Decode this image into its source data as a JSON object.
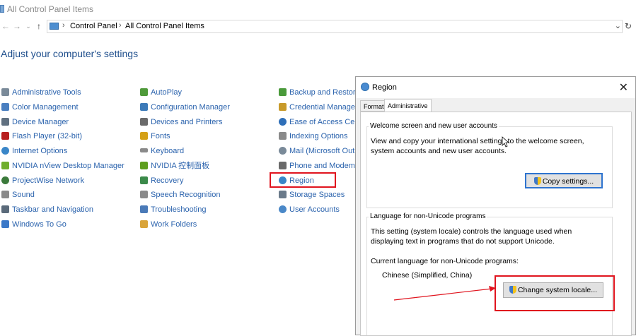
{
  "window": {
    "title": "All Control Panel Items"
  },
  "address": {
    "crumbs": [
      "Control Panel",
      "All Control Panel Items"
    ],
    "sep": "›",
    "back_icon": "back-arrow-icon",
    "forward_icon": "forward-arrow-icon",
    "up_icon": "up-arrow-icon"
  },
  "heading": "Adjust your computer's settings",
  "columns": [
    {
      "items": [
        {
          "label": "Administrative Tools",
          "icon": "admin-tools-icon",
          "color": "#7a8a99"
        },
        {
          "label": "Color Management",
          "icon": "color-management-icon",
          "color": "#4a7fc0"
        },
        {
          "label": "Device Manager",
          "icon": "device-manager-icon",
          "color": "#607080"
        },
        {
          "label": "Flash Player (32-bit)",
          "icon": "flash-player-icon",
          "color": "#b81f1f"
        },
        {
          "label": "Internet Options",
          "icon": "internet-options-icon",
          "color": "#3a86c8"
        },
        {
          "label": "NVIDIA nView Desktop Manager",
          "icon": "nvidia-nview-icon",
          "color": "#6fae2d"
        },
        {
          "label": "ProjectWise  Network",
          "icon": "projectwise-icon",
          "color": "#3b7a3b"
        },
        {
          "label": "Sound",
          "icon": "sound-icon",
          "color": "#8a8a8a"
        },
        {
          "label": "Taskbar and Navigation",
          "icon": "taskbar-icon",
          "color": "#5a6a7a"
        },
        {
          "label": "Windows To Go",
          "icon": "windows-to-go-icon",
          "color": "#3a78c8"
        }
      ]
    },
    {
      "items": [
        {
          "label": "AutoPlay",
          "icon": "autoplay-icon",
          "color": "#4f9a3a"
        },
        {
          "label": "Configuration Manager",
          "icon": "configuration-manager-icon",
          "color": "#3c7ab8"
        },
        {
          "label": "Devices and Printers",
          "icon": "devices-printers-icon",
          "color": "#6a6a6a"
        },
        {
          "label": "Fonts",
          "icon": "fonts-icon",
          "color": "#d4a017"
        },
        {
          "label": "Keyboard",
          "icon": "keyboard-icon",
          "color": "#8a8a8a"
        },
        {
          "label": "NVIDIA 控制面板",
          "icon": "nvidia-control-panel-icon",
          "color": "#5e9e1e"
        },
        {
          "label": "Recovery",
          "icon": "recovery-icon",
          "color": "#3b8a4a"
        },
        {
          "label": "Speech Recognition",
          "icon": "speech-recognition-icon",
          "color": "#8a8a8a"
        },
        {
          "label": "Troubleshooting",
          "icon": "troubleshooting-icon",
          "color": "#4a7ab8"
        },
        {
          "label": "Work Folders",
          "icon": "work-folders-icon",
          "color": "#d9a43a"
        }
      ]
    },
    {
      "items": [
        {
          "label": "Backup and Restore (Wi",
          "icon": "backup-restore-icon",
          "color": "#4a9a3a"
        },
        {
          "label": "Credential Manager",
          "icon": "credential-manager-icon",
          "color": "#c89a2a"
        },
        {
          "label": "Ease of Access Center",
          "icon": "ease-of-access-icon",
          "color": "#2f6fb8"
        },
        {
          "label": "Indexing Options",
          "icon": "indexing-options-icon",
          "color": "#8a8a8a"
        },
        {
          "label": "Mail (Microsoft Outlo",
          "icon": "mail-icon",
          "color": "#7a8a99"
        },
        {
          "label": "Phone and Modem",
          "icon": "phone-modem-icon",
          "color": "#6a6a6a"
        },
        {
          "label": "Region",
          "icon": "region-icon",
          "color": "#3a86c8"
        },
        {
          "label": "Storage Spaces",
          "icon": "storage-spaces-icon",
          "color": "#6a7a8a"
        },
        {
          "label": "User Accounts",
          "icon": "user-accounts-icon",
          "color": "#4a88c8"
        }
      ]
    }
  ],
  "dialog": {
    "title": "Region",
    "title_icon": "globe-icon",
    "tabs": [
      "Formats",
      "Administrative"
    ],
    "welcome": {
      "label": "Welcome screen and new user accounts",
      "text": "View and copy your international settings to the welcome screen, system accounts and new user accounts.",
      "button": "Copy settings..."
    },
    "unicode": {
      "label": "Language for non-Unicode programs",
      "text": "This setting (system locale) controls the language used when displaying text in programs that do not support Unicode.",
      "current_label": "Current language for non-Unicode programs:",
      "current_value": "Chinese (Simplified, China)",
      "button": "Change system locale..."
    }
  },
  "accent": {
    "highlight": "#e0141e",
    "link": "#1e5aa8"
  }
}
